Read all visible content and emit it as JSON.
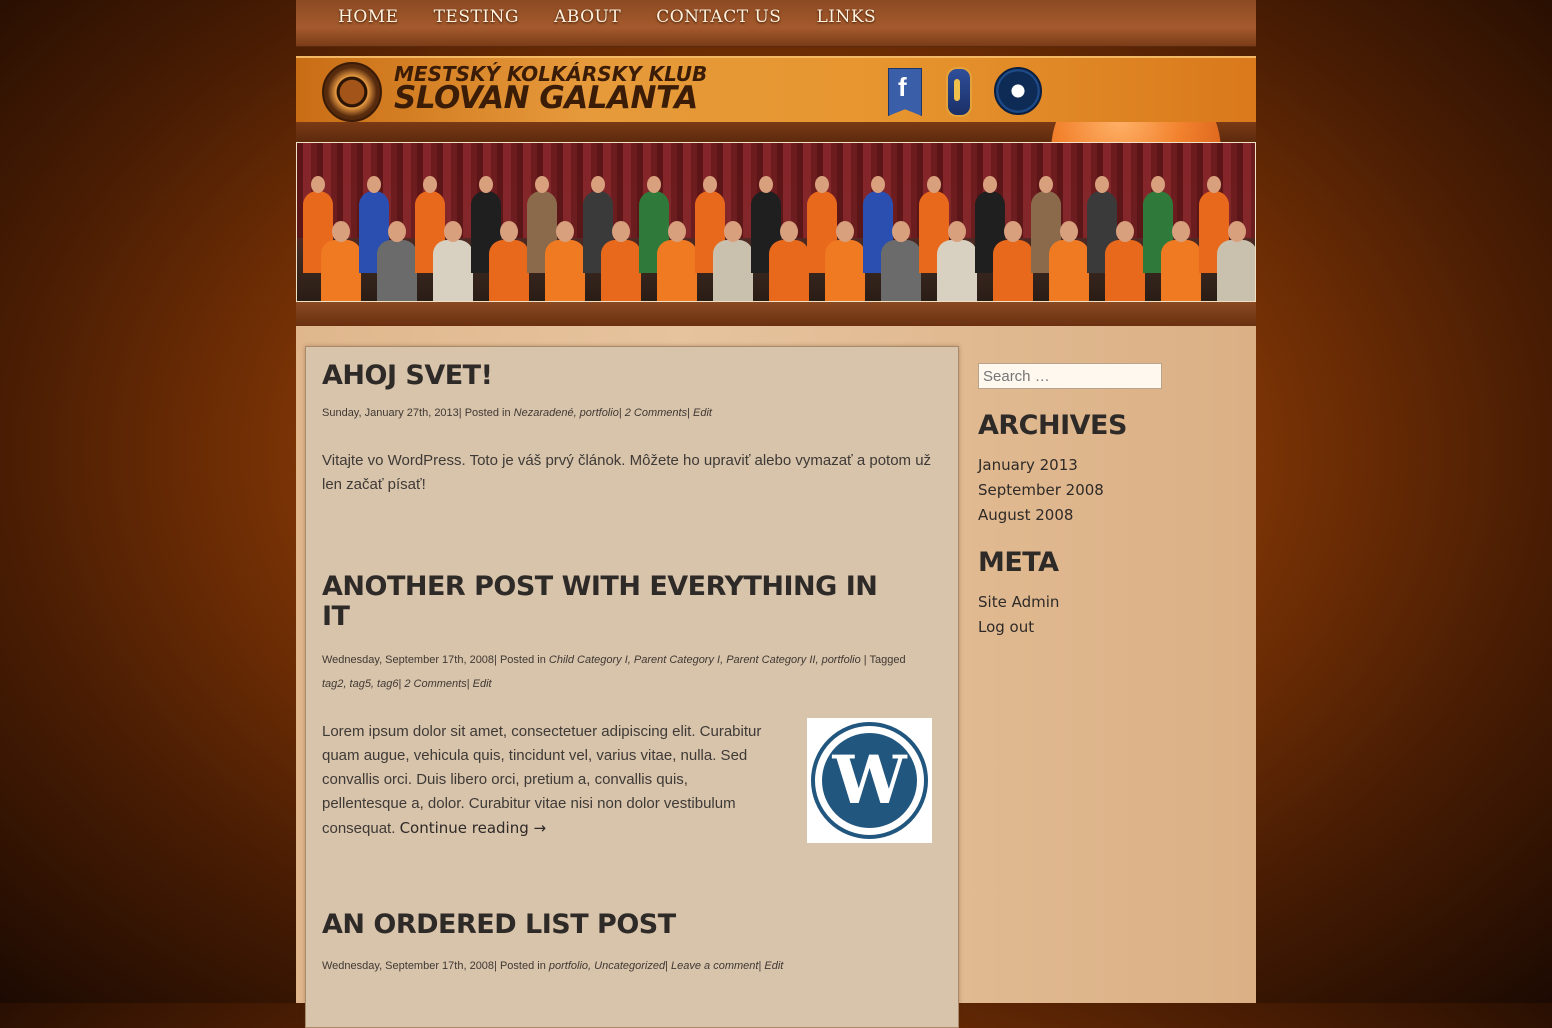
{
  "nav": {
    "items": [
      "HOME",
      "TESTING",
      "ABOUT",
      "CONTACT US",
      "LINKS"
    ]
  },
  "header": {
    "logo_line1": "MESTSKÝ KOLKÁRSKY KLUB",
    "logo_line2": "SLOVAN GALANTA",
    "facebook_glyph": "f",
    "icons": [
      "facebook-icon",
      "award-badge-icon",
      "guinness-world-records-icon"
    ]
  },
  "posts": [
    {
      "title": "AHOJ SVET!",
      "date": "Sunday, January 27th, 2013",
      "posted_in_label": "| Posted in ",
      "categories": "Nezaradené, portfolio",
      "comments": "2 Comments",
      "edit": "Edit",
      "body": "Vitajte vo WordPress. Toto je váš prvý článok. Môžete ho upraviť alebo vymazať a potom už len začať písať!"
    },
    {
      "title": "ANOTHER POST WITH EVERYTHING IN IT",
      "date": "Wednesday, September 17th, 2008",
      "posted_in_label": "| Posted in ",
      "categories": "Child Category I, Parent Category I, Parent Category II, portfolio",
      "tagged_label": "| Tagged",
      "tags": "tag2, tag5, tag6",
      "comments": "2 Comments",
      "edit": "Edit",
      "body": "Lorem ipsum dolor sit amet, consectetuer adipiscing elit. Curabitur quam augue, vehicula quis, tincidunt vel, varius vitae, nulla. Sed convallis orci. Duis libero orci, pretium a, convallis quis, pellentesque a, dolor. Curabitur vitae nisi non dolor vestibulum consequat.",
      "continue": "Continue reading →",
      "image_glyph": "W"
    },
    {
      "title": "AN ORDERED LIST POST",
      "date": "Wednesday, September 17th, 2008",
      "posted_in_label": "| Posted in ",
      "categories": "portfolio, Uncategorized",
      "comments": "Leave a comment",
      "edit": "Edit"
    }
  ],
  "sidebar": {
    "search_placeholder": "Search …",
    "archives_title": "ARCHIVES",
    "archives": [
      "January 2013",
      "September 2008",
      "August 2008"
    ],
    "meta_title": "META",
    "meta": [
      "Site Admin",
      "Log out"
    ]
  },
  "colors": {
    "page_bg": "#8a3a06",
    "banner": "#e69a3b",
    "content_bg": "#d8c3ab",
    "heading": "#2e2a27",
    "wordpress_blue": "#21567f"
  }
}
